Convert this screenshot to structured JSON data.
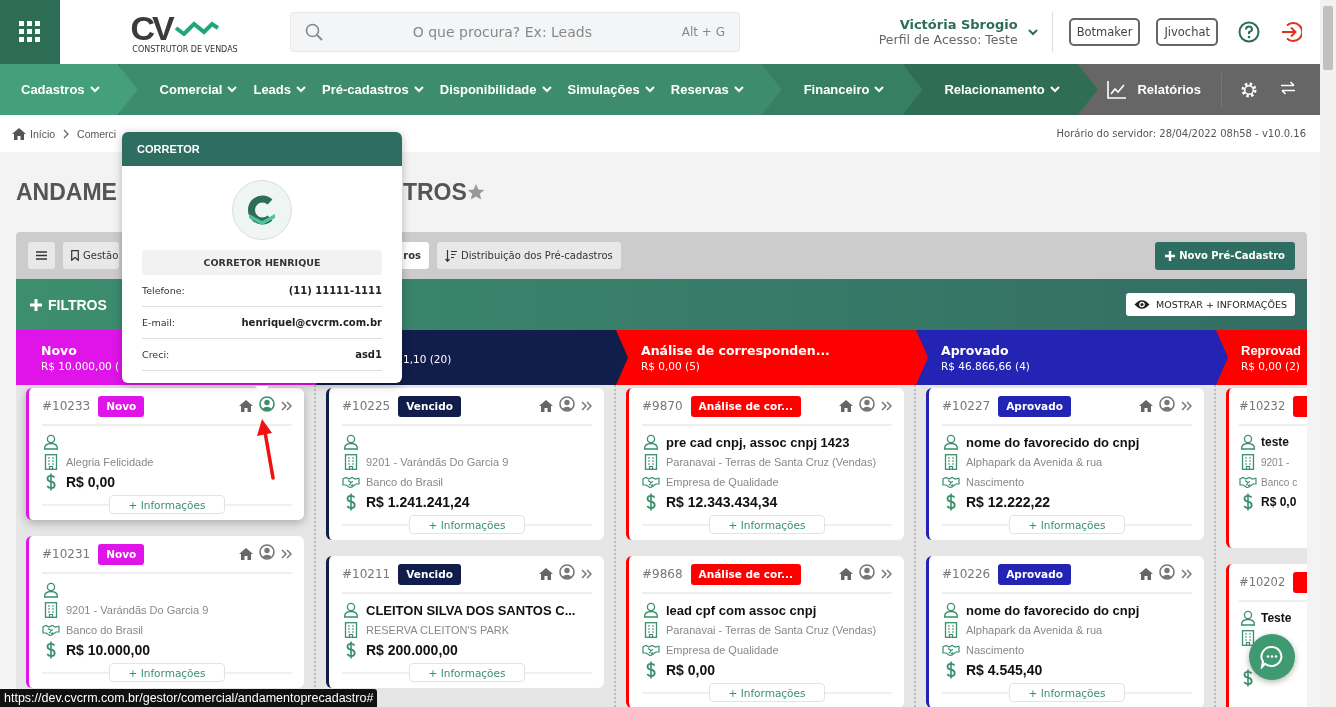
{
  "header": {
    "logo": {
      "mark": "CV",
      "tagline": "CONSTRUTOR DE VENDAS"
    },
    "search": {
      "placeholder": "O que procura? Ex: Leads",
      "shortcut": "Alt + G"
    },
    "user": {
      "name": "Victória Sbrogio",
      "profile": "Perfil de Acesso: Teste"
    },
    "buttons": [
      "Botmaker",
      "Jivochat"
    ]
  },
  "nav": {
    "groups": [
      {
        "items": [
          "Cadastros"
        ]
      },
      {
        "items": [
          "Comercial",
          "Leads",
          "Pré-cadastros",
          "Disponibilidade",
          "Simulações",
          "Reservas"
        ]
      },
      {
        "items": [
          "Financeiro"
        ]
      },
      {
        "items": [
          "Relacionamento"
        ]
      }
    ],
    "reports": "Relatórios"
  },
  "breadcrumb": {
    "items": [
      "Início",
      "Comerci"
    ],
    "server_time": "Horário do servidor: 28/04/2022 08h58 - v10.0.16"
  },
  "title_parts": [
    "ANDAME",
    "TROS"
  ],
  "toolbar": {
    "tabs": [
      {
        "label": "Gestão",
        "selected": false
      },
      {
        "label": "ros",
        "selected": true
      }
    ],
    "distribution": "Distribuição dos Pré-cadastros",
    "new_button": "Novo Pré-Cadastro"
  },
  "filters": {
    "label": "FILTROS",
    "show_more": "MOSTRAR + INFORMAÇÕES"
  },
  "columns": [
    {
      "title": "Novo",
      "total": "R$ 10.000,00 (",
      "color": "#e014e8",
      "cards": [
        {
          "id": "#10233",
          "badge": "Novo",
          "active": true,
          "rows": [
            {
              "kind": "person"
            },
            {
              "kind": "building",
              "text": "Alegria Felicidade"
            },
            {
              "kind": "value",
              "text": "R$ 0,00"
            }
          ],
          "info": "+ Informações"
        },
        {
          "id": "#10231",
          "badge": "Novo",
          "active": false,
          "rows": [
            {
              "kind": "person"
            },
            {
              "kind": "building",
              "text": "9201 - Varándãs Do Garcia 9"
            },
            {
              "kind": "bank",
              "text": "Banco do Brasil"
            },
            {
              "kind": "value",
              "text": "R$ 10.000,00"
            }
          ],
          "info": "+ Informações"
        }
      ]
    },
    {
      "total": "1,10 (20)",
      "color": "#111d4a",
      "cards": [
        {
          "id": "#10225",
          "badge": "Vencido",
          "active": false,
          "rows": [
            {
              "kind": "person"
            },
            {
              "kind": "building",
              "text": "9201 - Varándãs Do Garcia 9"
            },
            {
              "kind": "bank",
              "text": "Banco do Brasil"
            },
            {
              "kind": "value",
              "text": "R$ 1.241.241,24"
            }
          ],
          "info": "+ Informações"
        },
        {
          "id": "#10211",
          "badge": "Vencido",
          "active": false,
          "rows": [
            {
              "kind": "person",
              "text": "CLEITON SILVA DOS SANTOS C..."
            },
            {
              "kind": "building",
              "text": "RESERVA CLEITON'S PARK"
            },
            {
              "kind": "value",
              "text": "R$ 200.000,00"
            }
          ],
          "info": "+ Informações"
        }
      ]
    },
    {
      "title": "Análise de corresponden...",
      "total": "R$ 0,00 (5)",
      "color": "#ff0000",
      "cards": [
        {
          "id": "#9870",
          "badge": "Análise de cor...",
          "active": false,
          "rows": [
            {
              "kind": "person",
              "text": "pre cad cnpj, assoc cnpj 1423"
            },
            {
              "kind": "building",
              "text": "Paranavai - Terras de Santa Cruz (Vendas)"
            },
            {
              "kind": "bank",
              "text": "Empresa de Qualidade"
            },
            {
              "kind": "value",
              "text": "R$ 12.343.434,34"
            }
          ],
          "info": "+ Informações"
        },
        {
          "id": "#9868",
          "badge": "Análise de cor...",
          "active": false,
          "rows": [
            {
              "kind": "person",
              "text": "lead cpf com assoc cnpj"
            },
            {
              "kind": "building",
              "text": "Paranavai - Terras de Santa Cruz (Vendas)"
            },
            {
              "kind": "bank",
              "text": "Empresa de Qualidade"
            },
            {
              "kind": "value",
              "text": "R$ 0,00"
            }
          ],
          "info": "+ Informações"
        }
      ]
    },
    {
      "title": "Aprovado",
      "total": "R$ 46.866,66 (4)",
      "color": "#2424b4",
      "cards": [
        {
          "id": "#10227",
          "badge": "Aprovado",
          "active": false,
          "rows": [
            {
              "kind": "person",
              "text": "nome do favorecido do cnpj"
            },
            {
              "kind": "building",
              "text": "Alphapark da Avenida & rua"
            },
            {
              "kind": "bank",
              "text": "Nascimento"
            },
            {
              "kind": "value",
              "text": "R$ 12.222,22"
            }
          ],
          "info": "+ Informações"
        },
        {
          "id": "#10226",
          "badge": "Aprovado",
          "active": false,
          "rows": [
            {
              "kind": "person",
              "text": "nome do favorecido do cnpj"
            },
            {
              "kind": "building",
              "text": "Alphapark da Avenida & rua"
            },
            {
              "kind": "bank",
              "text": "Nascimento"
            },
            {
              "kind": "value",
              "text": "R$ 4.545,40"
            }
          ],
          "info": "+ Informações"
        }
      ]
    },
    {
      "title": "Reprovad",
      "total": "R$ 0,00 (2)",
      "color": "#ff0000",
      "cards": [
        {
          "id": "#10232",
          "rows": [
            {
              "kind": "person",
              "text": "teste"
            },
            {
              "kind": "building",
              "text": "9201 -"
            },
            {
              "kind": "bank",
              "text": "Banco c"
            },
            {
              "kind": "value",
              "text": "R$ 0,0"
            }
          ]
        },
        {
          "id": "#10202",
          "rows": [
            {
              "kind": "person",
              "text": "Teste"
            },
            {
              "kind": "building"
            },
            {
              "kind": "bank"
            },
            {
              "kind": "value"
            }
          ]
        }
      ]
    }
  ],
  "popover": {
    "title": "CORRETOR",
    "name": "CORRETOR HENRIQUE",
    "fields": [
      {
        "label": "Telefone:",
        "value": "(11) 11111-1111"
      },
      {
        "label": "E-mail:",
        "value": "henriquel@cvcrm.com.br"
      },
      {
        "label": "Creci:",
        "value": "asd1"
      }
    ]
  },
  "status_url": "https://dev.cvcrm.com.br/gestor/comercial/andamentoprecadastro#"
}
